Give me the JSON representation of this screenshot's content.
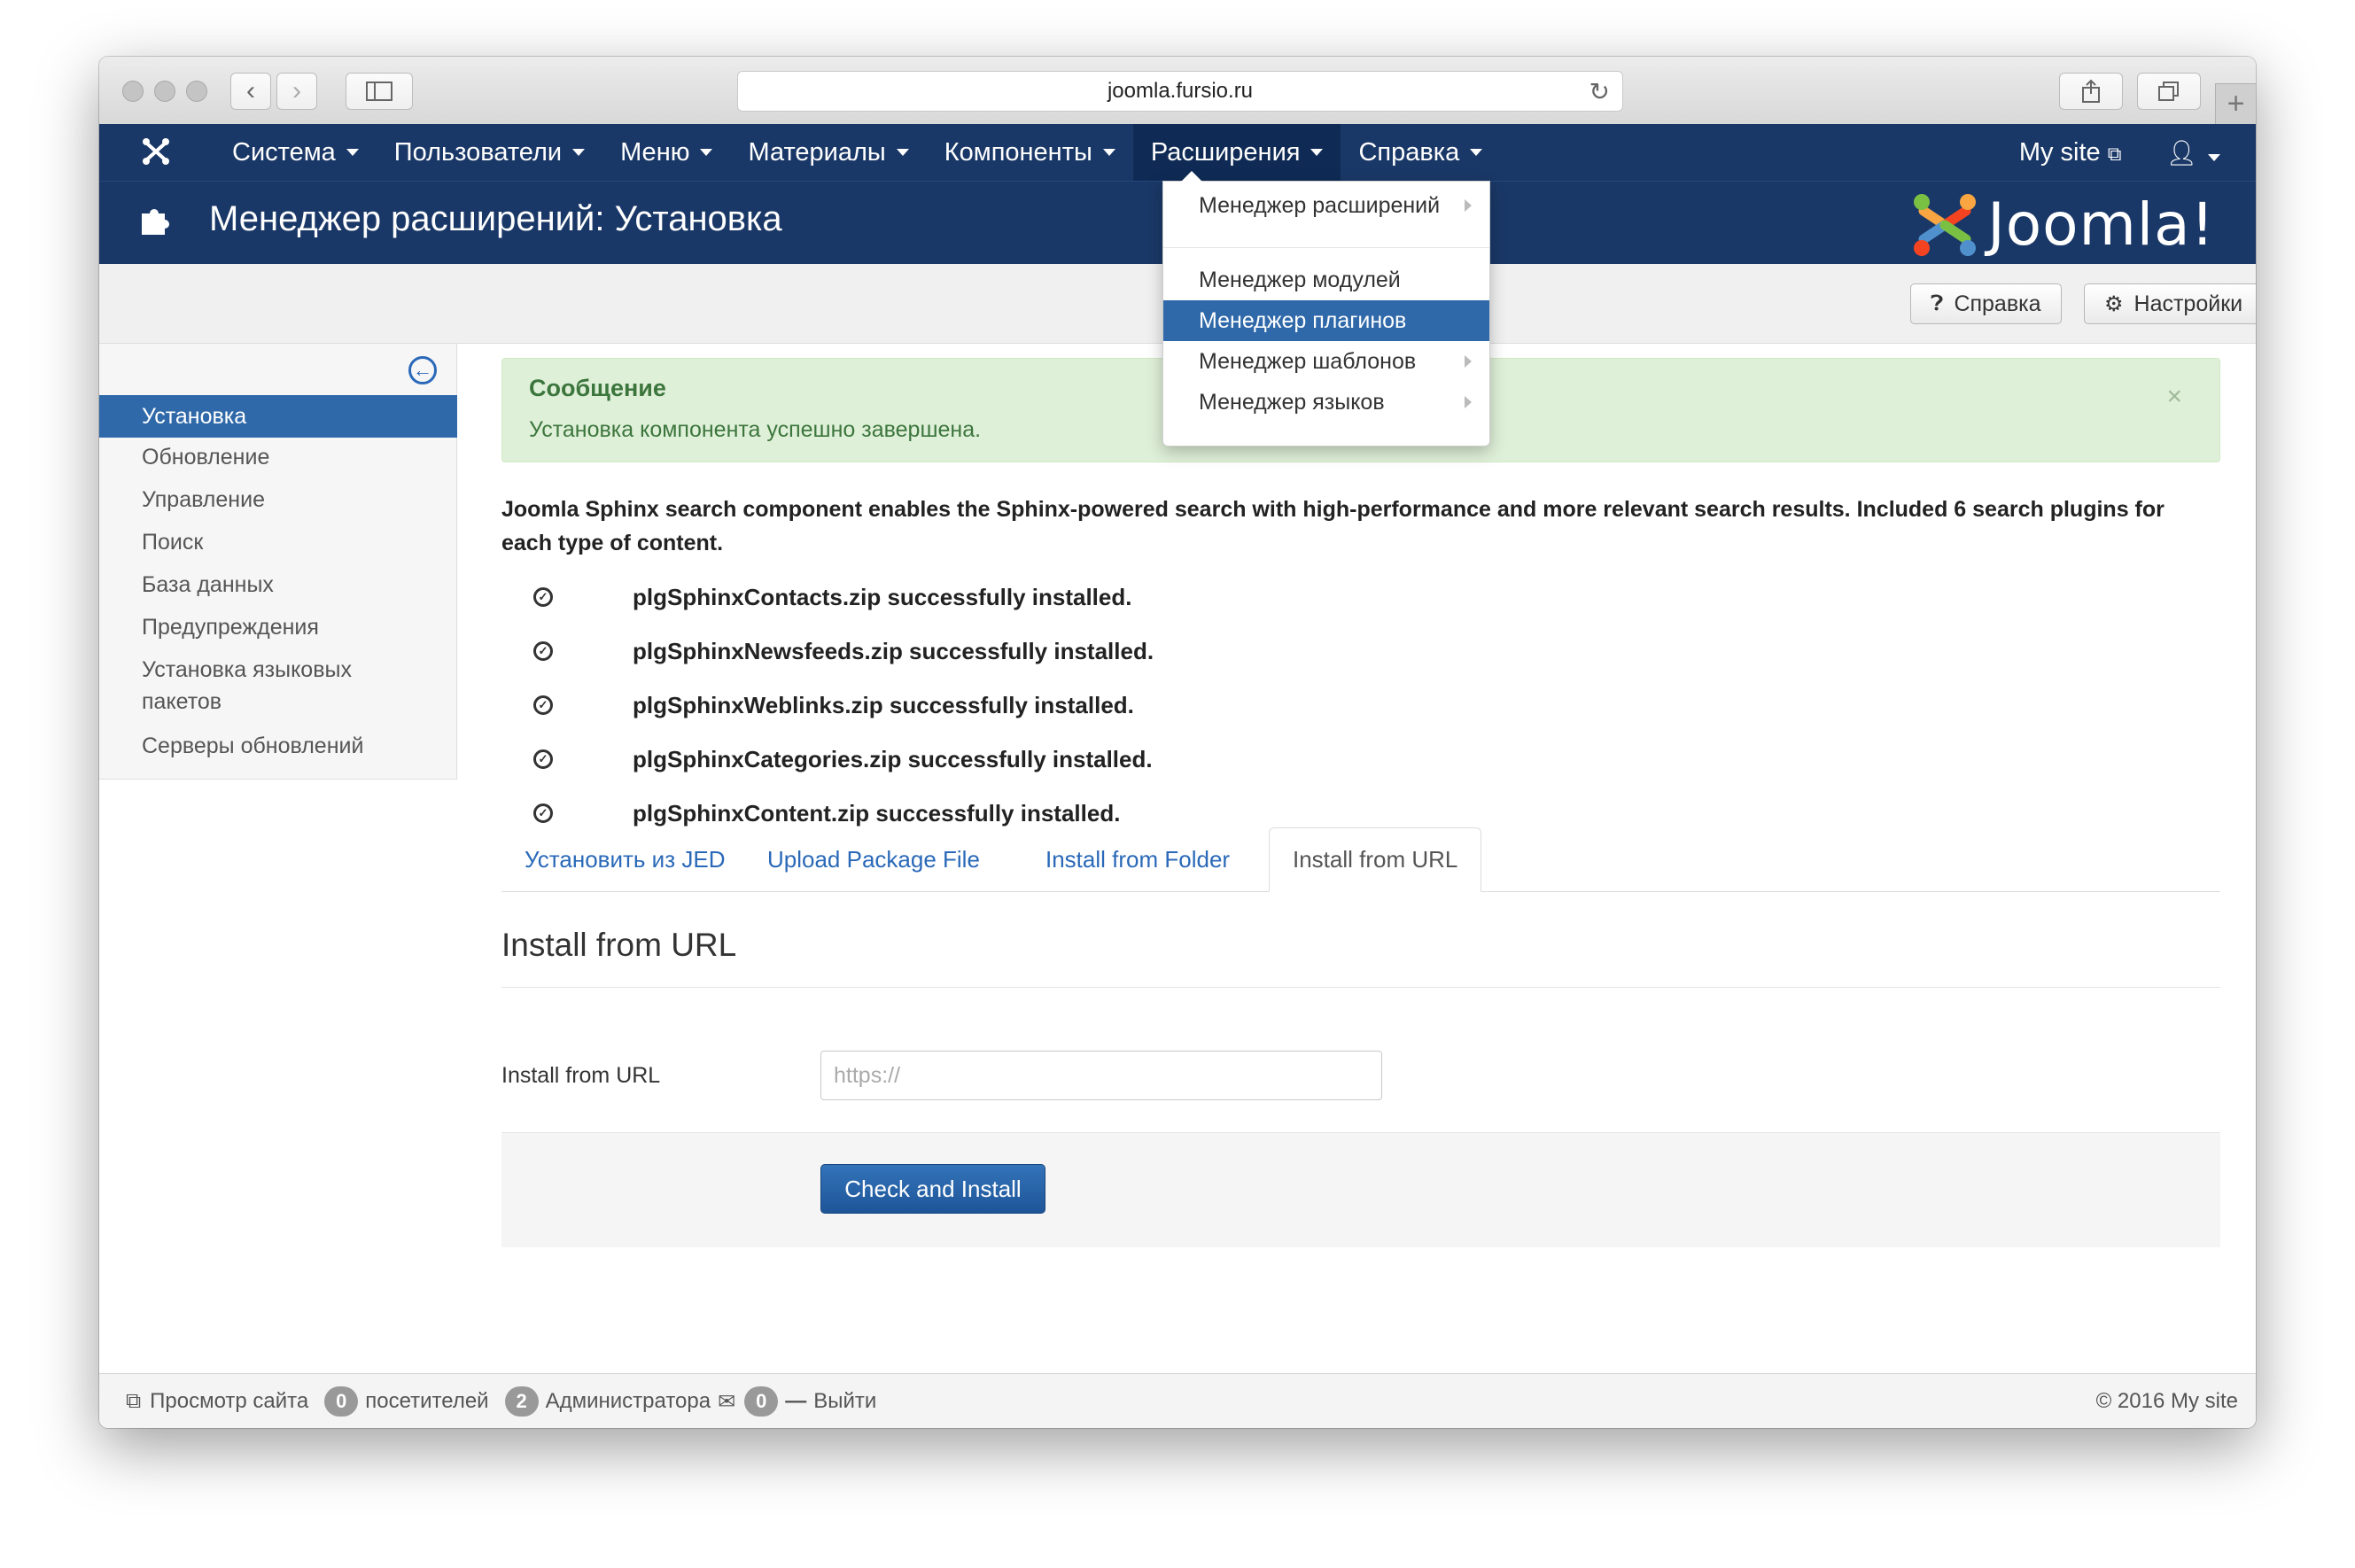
{
  "browser": {
    "url": "joomla.fursio.ru"
  },
  "topnav": {
    "items": [
      {
        "label": "Система"
      },
      {
        "label": "Пользователи"
      },
      {
        "label": "Меню"
      },
      {
        "label": "Материалы"
      },
      {
        "label": "Компоненты"
      },
      {
        "label": "Расширения"
      },
      {
        "label": "Справка"
      }
    ],
    "mysite": "My site"
  },
  "dropdown": {
    "items": [
      {
        "label": "Менеджер расширений",
        "submenu": true
      },
      {
        "label": "Менеджер модулей",
        "submenu": false
      },
      {
        "label": "Менеджер плагинов",
        "submenu": false
      },
      {
        "label": "Менеджер шаблонов",
        "submenu": true
      },
      {
        "label": "Менеджер языков",
        "submenu": true
      }
    ]
  },
  "header": {
    "title": "Менеджер расширений: Установка",
    "brand": "Joomla!"
  },
  "toolbar": {
    "help": "Справка",
    "options": "Настройки"
  },
  "sidebar": {
    "items": [
      {
        "label": "Установка"
      },
      {
        "label": "Обновление"
      },
      {
        "label": "Управление"
      },
      {
        "label": "Поиск"
      },
      {
        "label": "База данных"
      },
      {
        "label": "Предупреждения"
      },
      {
        "label": "Установка языковых пакетов"
      },
      {
        "label": "Серверы обновлений"
      }
    ]
  },
  "message": {
    "heading": "Сообщение",
    "text": "Установка компонента успешно завершена.",
    "close": "×"
  },
  "description": "Joomla Sphinx search component enables the Sphinx-powered search with high-performance and more relevant search results. Included 6 search plugins for each type of content.",
  "installed": [
    "plgSphinxContacts.zip successfully installed.",
    "plgSphinxNewsfeeds.zip successfully installed.",
    "plgSphinxWeblinks.zip successfully installed.",
    "plgSphinxCategories.zip successfully installed.",
    "plgSphinxContent.zip successfully installed."
  ],
  "tabs": [
    {
      "label": "Установить из JED"
    },
    {
      "label": "Upload Package File"
    },
    {
      "label": "Install from Folder"
    },
    {
      "label": "Install from URL"
    }
  ],
  "form": {
    "section_title": "Install from URL",
    "field_label": "Install from URL",
    "placeholder": "https://",
    "submit": "Check and Install"
  },
  "status": {
    "view_site": "Просмотр сайта",
    "visitors_count": "0",
    "visitors_label": "посетителей",
    "admins_count": "2",
    "admins_label": "Администратора",
    "messages_count": "0",
    "logout": "Выйти",
    "copyright": "© 2016 My site"
  }
}
